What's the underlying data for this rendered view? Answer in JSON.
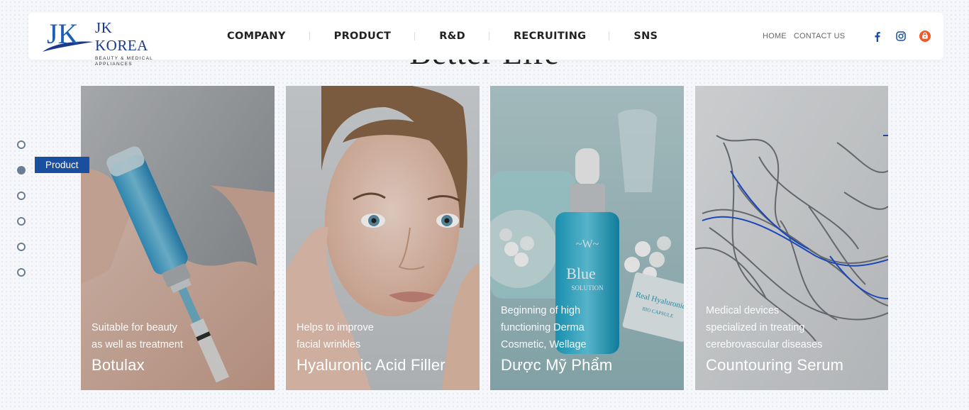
{
  "logo": {
    "mark": "JK",
    "title": "JK KOREA",
    "subtitle": "BEAUTY & MEDICAL APPLIANCES"
  },
  "nav": {
    "items": [
      "COMPANY",
      "PRODUCT",
      "R&D",
      "RECRUITING",
      "SNS"
    ]
  },
  "utility": {
    "home": "HOME",
    "contact": "CONTACT US"
  },
  "social": [
    "facebook-icon",
    "instagram-icon",
    "shop-icon"
  ],
  "section": {
    "heading": "Better Life"
  },
  "side_nav": {
    "active_label": "Product",
    "count": 6,
    "active_index": 1
  },
  "cards": [
    {
      "desc": "Suitable for beauty\nas well as treatment",
      "title": "Botulax"
    },
    {
      "desc": "Helps to improve\nfacial wrinkles",
      "title": "Hyaluronic Acid Filler"
    },
    {
      "desc": "Beginning of high\nfunctioning Derma\nCosmetic, Wellage",
      "title": "Dược Mỹ Phẩm"
    },
    {
      "desc": "Medical devices\nspecialized in treating\ncerebrovascular diseases",
      "title": "Countouring Serum"
    }
  ],
  "product_labels": {
    "bottle_brand": "Blue",
    "bottle_sub": "SOLUTION",
    "box_brand": "Real Hyaluronic",
    "box_sub": "BIO CAPSULE"
  },
  "colors": {
    "accent": "#1a4fa0",
    "logo": "#1b3a8c",
    "dot": "#6b7d90",
    "shop": "#f05a28"
  }
}
